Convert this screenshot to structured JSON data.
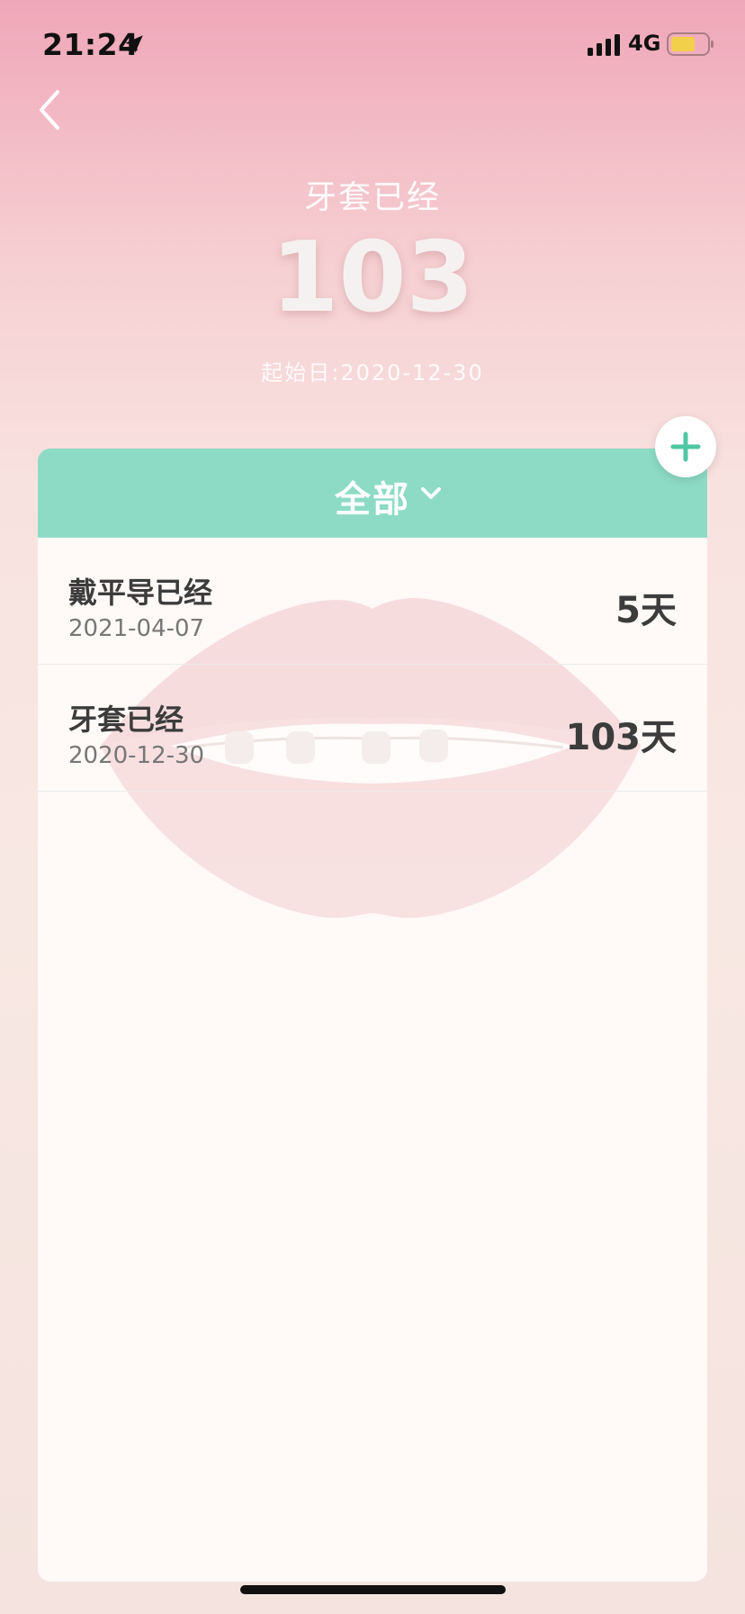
{
  "status_bar": {
    "time": "21:24",
    "network": "4G",
    "icons": [
      "location-arrow-icon",
      "signal-icon",
      "battery-icon"
    ],
    "battery_color": "#f2d04a"
  },
  "header": {
    "title": "牙套已经",
    "count": "103",
    "start_date": "起始日:2020-12-30",
    "back_icon": "chevron-left-icon"
  },
  "filter": {
    "label": "全部",
    "icon": "chevron-down-icon",
    "color": "#8ddbc5"
  },
  "add_button": {
    "icon": "plus-icon",
    "color": "#4fc7a3"
  },
  "items": [
    {
      "title": "戴平导已经",
      "date": "2021-04-07",
      "days": "5天"
    },
    {
      "title": "牙套已经",
      "date": "2020-12-30",
      "days": "103天"
    }
  ]
}
